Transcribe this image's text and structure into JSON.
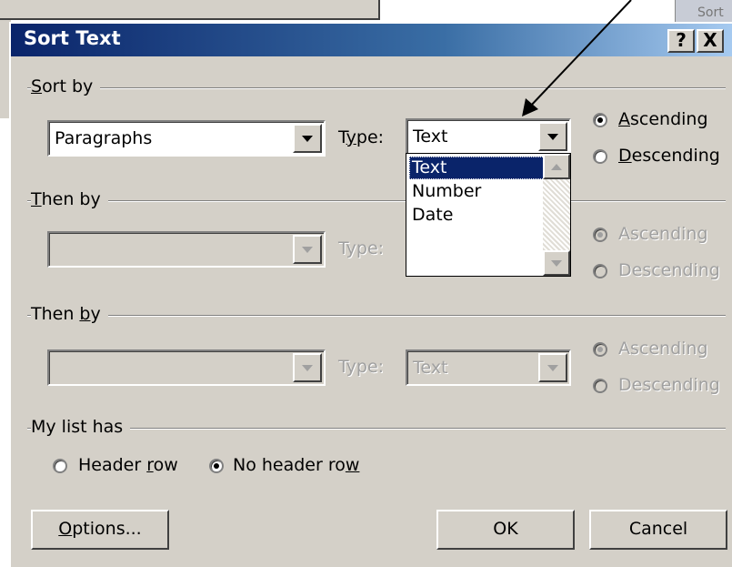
{
  "background": {
    "partial_button": "Sort"
  },
  "dialog": {
    "title": "Sort Text",
    "help_button": "?",
    "close_button": "X"
  },
  "sort_by": {
    "label": "Sort by",
    "field_value": "Paragraphs",
    "type_label": "Type:",
    "type_value": "Text",
    "ascending": "Ascending",
    "descending": "Descending",
    "selected": "Ascending"
  },
  "then_by_1": {
    "label": "Then by",
    "field_value": "",
    "type_label": "Type:",
    "ascending": "Ascending",
    "descending": "Descending",
    "selected": "Ascending",
    "disabled": true
  },
  "then_by_2": {
    "label": "Then by",
    "field_value": "",
    "type_label": "Type:",
    "type_value": "Text",
    "ascending": "Ascending",
    "descending": "Descending",
    "selected": "Ascending",
    "disabled": true
  },
  "type_dropdown": {
    "options": [
      "Text",
      "Number",
      "Date"
    ],
    "highlighted": "Text"
  },
  "list_has": {
    "label": "My list has",
    "header_row": "Header row",
    "no_header_row": "No header row",
    "selected": "No header row"
  },
  "buttons": {
    "options": "Options...",
    "ok": "OK",
    "cancel": "Cancel"
  },
  "annotation": {
    "arrow": "pointer-arrow"
  }
}
